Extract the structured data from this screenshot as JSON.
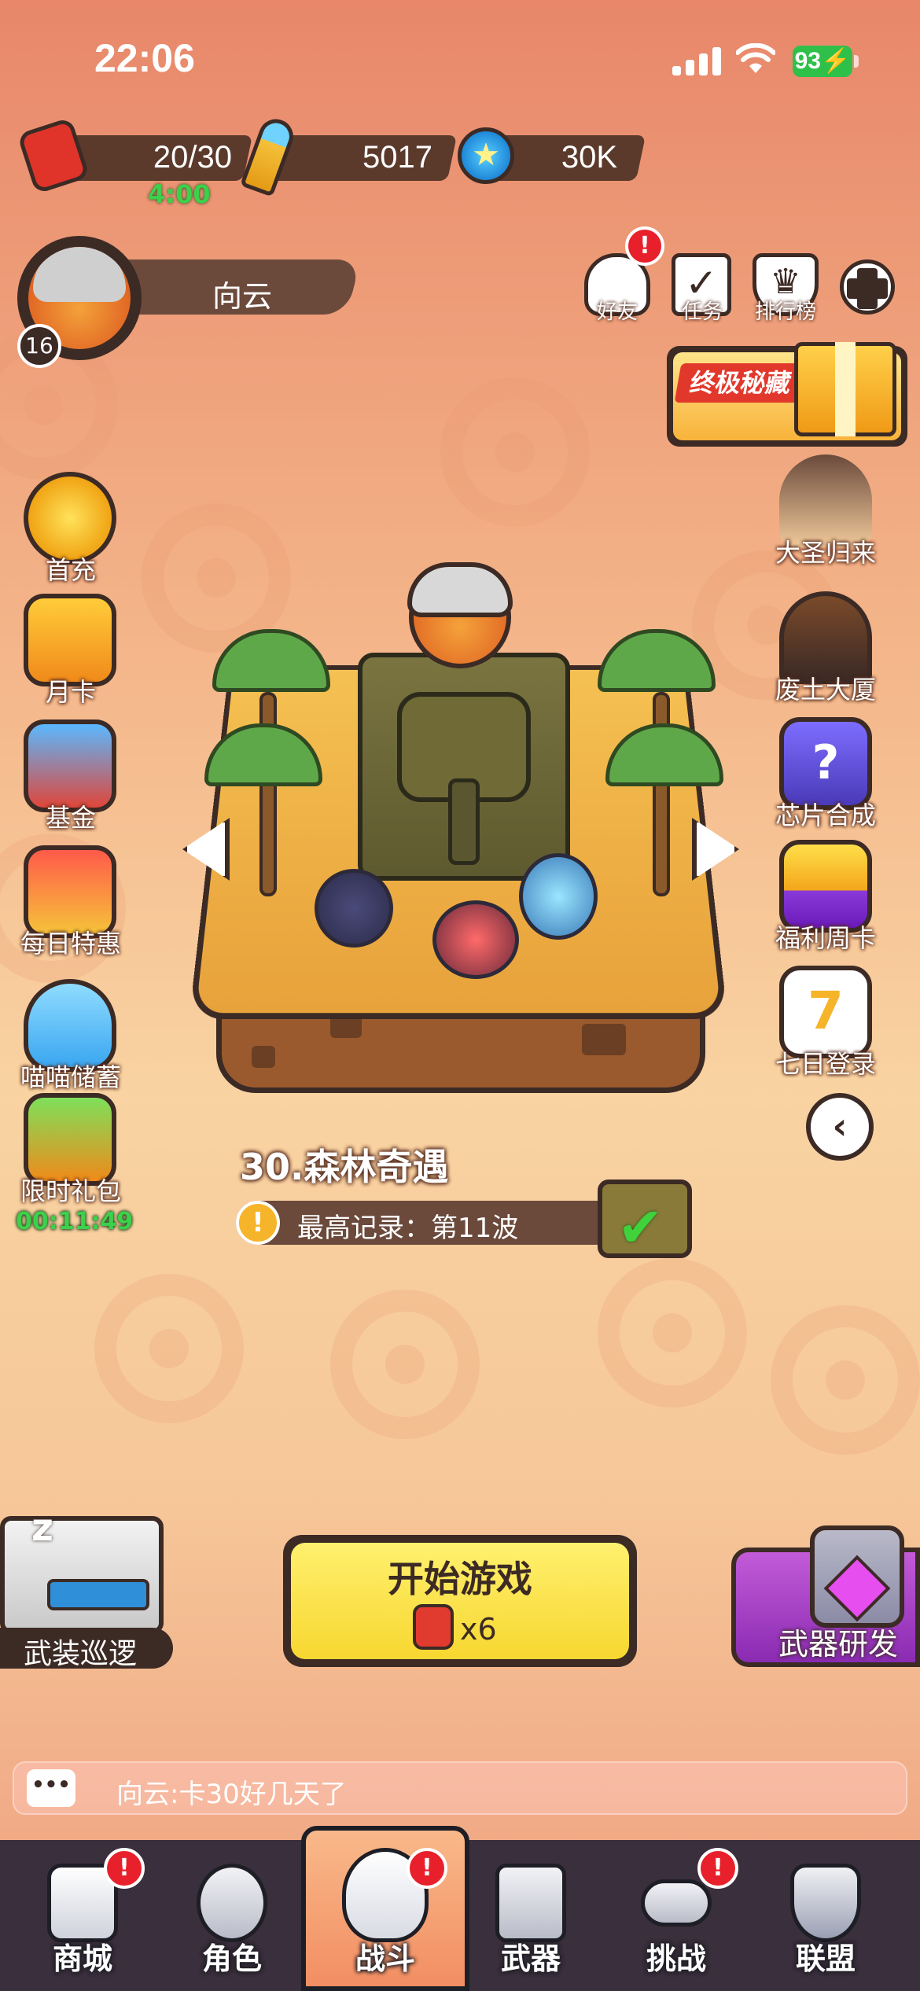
{
  "status_bar": {
    "time": "22:06",
    "battery": "93"
  },
  "resources": {
    "energy": {
      "value": "20/30",
      "timer": "4:00"
    },
    "bullets": {
      "value": "5017"
    },
    "caps": {
      "value": "30K"
    }
  },
  "profile": {
    "name": "向云",
    "level": "16"
  },
  "top_menu": [
    {
      "label": "好友",
      "icon": "friends-icon",
      "badge": "!"
    },
    {
      "label": "任务",
      "icon": "tasks-icon"
    },
    {
      "label": "排行榜",
      "icon": "ranking-icon"
    },
    {
      "label": "",
      "icon": "game-controller-icon"
    }
  ],
  "ultimate_treasure": {
    "label": "终极秘藏"
  },
  "left_sidebar": [
    {
      "label": "首充",
      "icon": "first-recharge-icon"
    },
    {
      "label": "月卡",
      "icon": "monthly-card-icon"
    },
    {
      "label": "基金",
      "icon": "fund-icon"
    },
    {
      "label": "每日特惠",
      "icon": "daily-deal-icon"
    },
    {
      "label": "喵喵储蓄",
      "icon": "cat-savings-icon"
    },
    {
      "label": "限时礼包",
      "icon": "limited-gift-icon",
      "timer": "00:11:49"
    }
  ],
  "right_sidebar": [
    {
      "label": "大圣归来",
      "icon": "monkey-king-icon"
    },
    {
      "label": "废土大厦",
      "icon": "wasteland-tower-icon"
    },
    {
      "label": "芯片合成",
      "icon": "chip-synthesis-icon"
    },
    {
      "label": "福利周卡",
      "icon": "weekly-card-icon"
    },
    {
      "label": "七日登录",
      "icon": "seven-day-login-icon"
    }
  ],
  "stage": {
    "title": "30.森林奇遇",
    "record": "最高记录：第11波"
  },
  "start_button": {
    "label": "开始游戏",
    "cost": "x6"
  },
  "patrol": {
    "label": "武装巡逻"
  },
  "weapon_research": {
    "label": "武器研发"
  },
  "chat": {
    "message": "向云:卡30好几天了"
  },
  "bottom_nav": [
    {
      "label": "商城",
      "badge": "!"
    },
    {
      "label": "角色"
    },
    {
      "label": "战斗",
      "badge": "!",
      "active": true
    },
    {
      "label": "武器"
    },
    {
      "label": "挑战",
      "badge": "!"
    },
    {
      "label": "联盟"
    }
  ],
  "colors": {
    "accent_yellow": "#f7d730",
    "dark_brown": "#3c2a25",
    "badge_red": "#e8202b",
    "timer_green": "#3ad24a"
  }
}
